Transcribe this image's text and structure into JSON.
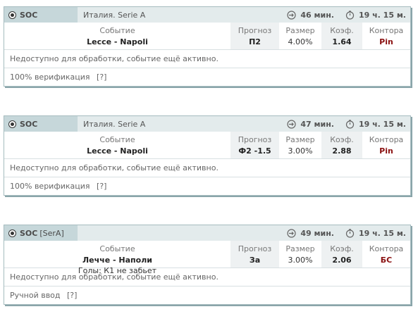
{
  "cards": [
    {
      "sport": "SOC",
      "sport_tag": "",
      "league": "Италия. Serie A",
      "time_left": "46 мин.",
      "time_total": "19 ч. 15 м.",
      "headers": {
        "event": "Событие",
        "forecast": "Прогноз",
        "size": "Размер",
        "coef": "Коэф.",
        "book": "Контора"
      },
      "event": "Lecce - Napoli",
      "event_sub": "",
      "forecast": "П2",
      "size": "4.00%",
      "coef": "1.64",
      "book": "Pin",
      "status": "Недоступно для обработки, событие ещё активно.",
      "verify": "100% верификация",
      "help": "[?]"
    },
    {
      "sport": "SOC",
      "sport_tag": "",
      "league": "Италия. Serie A",
      "time_left": "47 мин.",
      "time_total": "19 ч. 15 м.",
      "headers": {
        "event": "Событие",
        "forecast": "Прогноз",
        "size": "Размер",
        "coef": "Коэф.",
        "book": "Контора"
      },
      "event": "Lecce - Napoli",
      "event_sub": "",
      "forecast": "Ф2 -1.5",
      "size": "3.00%",
      "coef": "2.88",
      "book": "Pin",
      "status": "Недоступно для обработки, событие ещё активно.",
      "verify": "100% верификация",
      "help": "[?]"
    },
    {
      "sport": "SOC",
      "sport_tag": "[SerA]",
      "league": "",
      "time_left": "49 мин.",
      "time_total": "19 ч. 15 м.",
      "headers": {
        "event": "Событие",
        "forecast": "Прогноз",
        "size": "Размер",
        "coef": "Коэф.",
        "book": "Контора"
      },
      "event": "Лечче - Наполи",
      "event_sub": "Голы: К1 не забьет",
      "forecast": "За",
      "size": "3.00%",
      "coef": "2.06",
      "book": "БС",
      "status": "Недоступно для обработки, событие ещё активно.",
      "verify": "Ручной ввод",
      "help": "[?]"
    }
  ],
  "icons": {
    "sport": "soccer-ball-icon",
    "time_left": "arrow-clock-icon",
    "time_total": "stopwatch-icon"
  },
  "colors": {
    "header_bg": "#e3ebec",
    "sport_bg": "#c6d7da",
    "border": "#a6bcbf",
    "book": "#8a1010"
  }
}
